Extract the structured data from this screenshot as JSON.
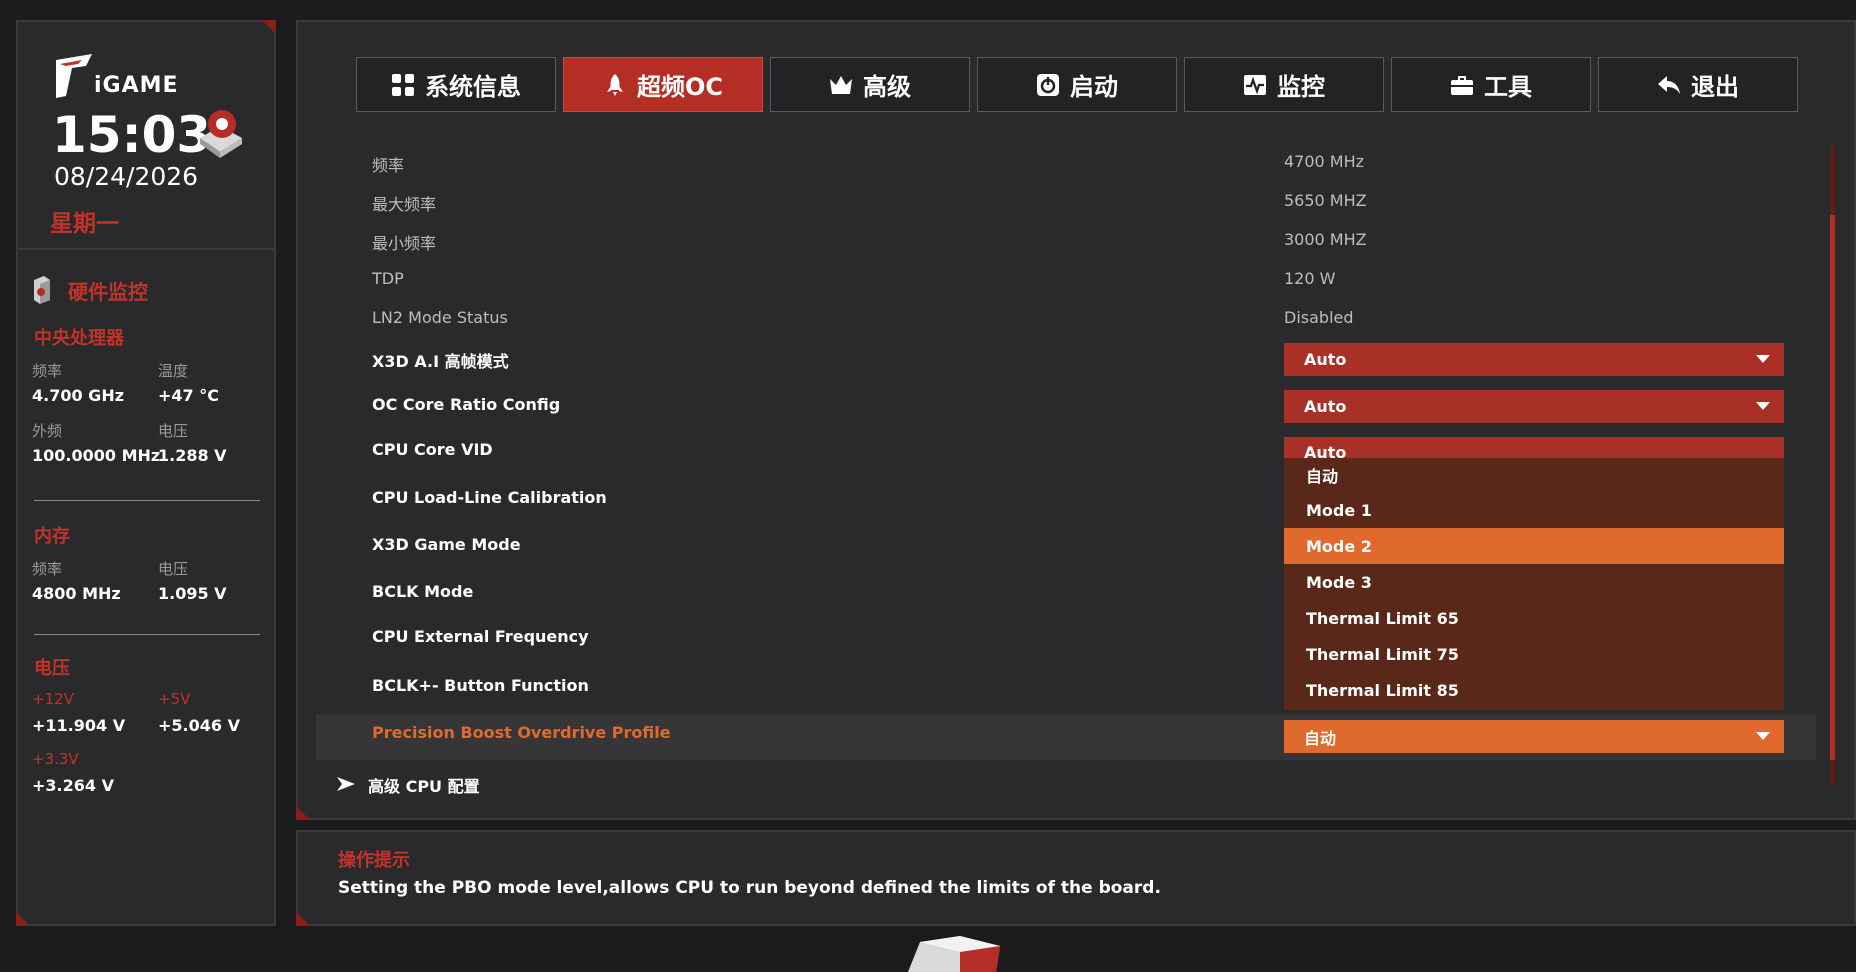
{
  "sidebar": {
    "time": "15:03",
    "date": "08/24/2026",
    "weekday": "星期一",
    "hw_title": "硬件监控",
    "cpu": {
      "title": "中央处理器",
      "freq_label": "频率",
      "freq_value": "4.700 GHz",
      "temp_label": "温度",
      "temp_value": "+47 °C",
      "ext_label": "外频",
      "ext_value": "100.0000 MHz",
      "volt_label": "电压",
      "volt_value": "1.288 V"
    },
    "memory": {
      "title": "内存",
      "freq_label": "频率",
      "freq_value": "4800 MHz",
      "volt_label": "电压",
      "volt_value": "1.095 V"
    },
    "voltage": {
      "title": "电压",
      "v12_label": "+12V",
      "v12_value": "+11.904 V",
      "v5_label": "+5V",
      "v5_value": "+5.046 V",
      "v33_label": "+3.3V",
      "v33_value": "+3.264 V"
    }
  },
  "tabs": [
    {
      "label": "系统信息",
      "icon": "grid-icon"
    },
    {
      "label": "超频OC",
      "icon": "rocket-icon",
      "active": true
    },
    {
      "label": "高级",
      "icon": "crown-icon"
    },
    {
      "label": "启动",
      "icon": "power-icon"
    },
    {
      "label": "监控",
      "icon": "monitor-icon"
    },
    {
      "label": "工具",
      "icon": "toolbox-icon"
    },
    {
      "label": "退出",
      "icon": "back-arrow-icon"
    }
  ],
  "settings": {
    "info": [
      {
        "label": "频率",
        "value": "4700 MHz"
      },
      {
        "label": "最大频率",
        "value": "5650 MHZ"
      },
      {
        "label": "最小频率",
        "value": "3000 MHZ"
      },
      {
        "label": "TDP",
        "value": "120 W"
      },
      {
        "label": "LN2 Mode Status",
        "value": "Disabled"
      }
    ],
    "items": [
      {
        "label": "X3D A.I 高帧模式",
        "value": "Auto"
      },
      {
        "label": "OC Core Ratio Config",
        "value": "Auto"
      },
      {
        "label": "CPU Core VID",
        "value": "Auto"
      },
      {
        "label": "CPU Load-Line Calibration"
      },
      {
        "label": "X3D Game Mode"
      },
      {
        "label": "BCLK Mode"
      },
      {
        "label": "CPU External Frequency"
      },
      {
        "label": "BCLK+- Button Function"
      },
      {
        "label": "Precision Boost Overdrive Profile",
        "value": "自动"
      }
    ],
    "submenu": "高级 CPU 配置"
  },
  "dropdown_options": [
    "自动",
    "Mode 1",
    "Mode 2",
    "Mode 3",
    "Thermal Limit 65",
    "Thermal Limit 75",
    "Thermal Limit 85"
  ],
  "dropdown_selected": "Mode 2",
  "hint": {
    "title": "操作提示",
    "text": "Setting the PBO mode level,allows CPU to run beyond defined the limits of the board."
  },
  "colors": {
    "accent": "#b52e25",
    "highlight": "#e06a2e",
    "menu_bg": "#5a2818"
  }
}
